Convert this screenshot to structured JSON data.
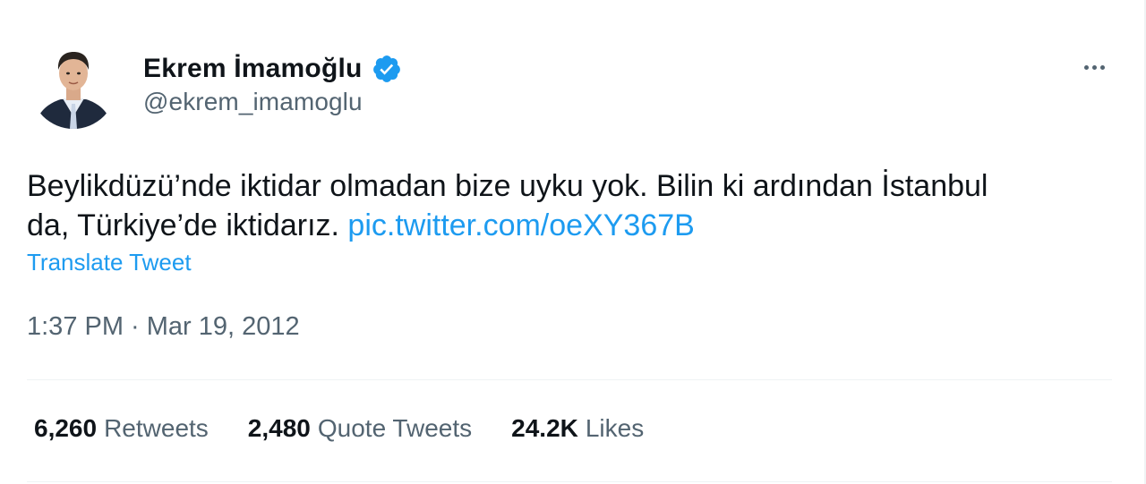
{
  "author": {
    "display_name": "Ekrem İmamoğlu",
    "handle": "@ekrem_imamoglu",
    "verified_icon": "verified-badge-icon"
  },
  "tweet": {
    "text_line1": "Beylikdüzü’nde iktidar olmadan bize uyku yok. Bilin ki ardından İstanbul",
    "text_line2": "da, Türkiye’de iktidarız. ",
    "link": "pic.twitter.com/oeXY367B",
    "translate_label": "Translate Tweet",
    "timestamp": "1:37 PM · Mar 19, 2012"
  },
  "stats": {
    "retweets_count": "6,260",
    "retweets_label": "Retweets",
    "quotes_count": "2,480",
    "quotes_label": "Quote Tweets",
    "likes_count": "24.2K",
    "likes_label": "Likes"
  },
  "colors": {
    "link": "#1d9bf0",
    "secondary_text": "#536471",
    "primary_text": "#0f1419"
  }
}
